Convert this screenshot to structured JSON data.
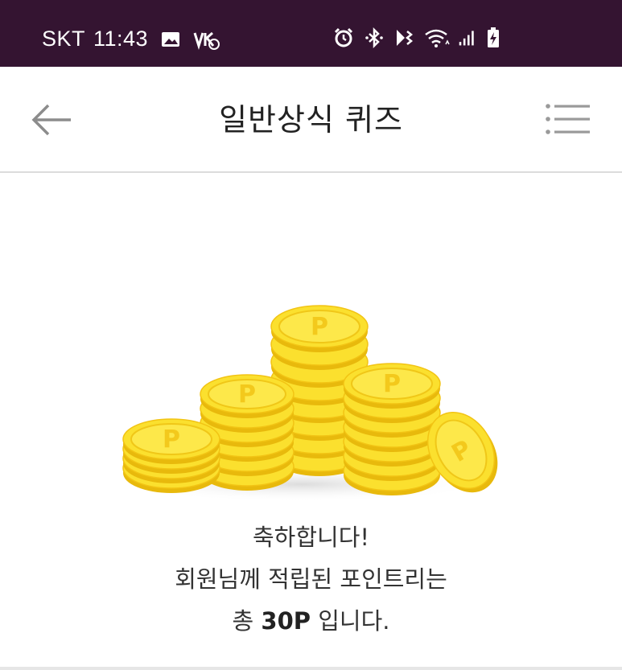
{
  "status_bar": {
    "carrier": "SKT",
    "time": "11:43",
    "icons": [
      "image-icon",
      "volte-icon",
      "alarm-icon",
      "bluetooth-icon",
      "vibrate-icon",
      "wifi-icon",
      "signal-icon",
      "battery-charging-icon"
    ],
    "background_color": "#341431"
  },
  "header": {
    "title": "일반상식 퀴즈",
    "back_icon": "arrow-left-icon",
    "menu_icon": "menu-list-icon"
  },
  "illustration": {
    "coin_letter": "P",
    "coin_color": "#fbe232"
  },
  "result": {
    "line1": "축하합니다!",
    "line2": "회원님께 적립된 포인트리는",
    "line3_prefix": "총 ",
    "points": "30P",
    "line3_suffix": " 입니다."
  }
}
